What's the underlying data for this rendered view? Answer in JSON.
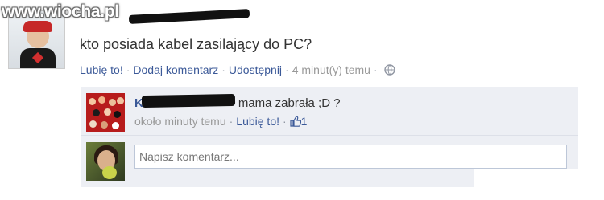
{
  "watermark": "www.wiocha.pl",
  "post": {
    "text": "kto posiada kabel zasilający do PC?",
    "actions": {
      "like": "Lubię to!",
      "comment": "Dodaj komentarz",
      "share": "Udostępnij",
      "time": "4 minut(y) temu"
    },
    "icons": {
      "privacy": "globe-icon"
    }
  },
  "comment": {
    "name_initial": "K",
    "text": "mama zabrała ;D ?",
    "time": "około minuty temu",
    "like": "Lubię to!",
    "like_count": "1",
    "icons": {
      "like": "thumbs-up-icon"
    }
  },
  "reply": {
    "placeholder": "Napisz komentarz..."
  },
  "colors": {
    "link": "#3b5998",
    "meta": "#999999",
    "comment_bg": "#edeff4"
  }
}
